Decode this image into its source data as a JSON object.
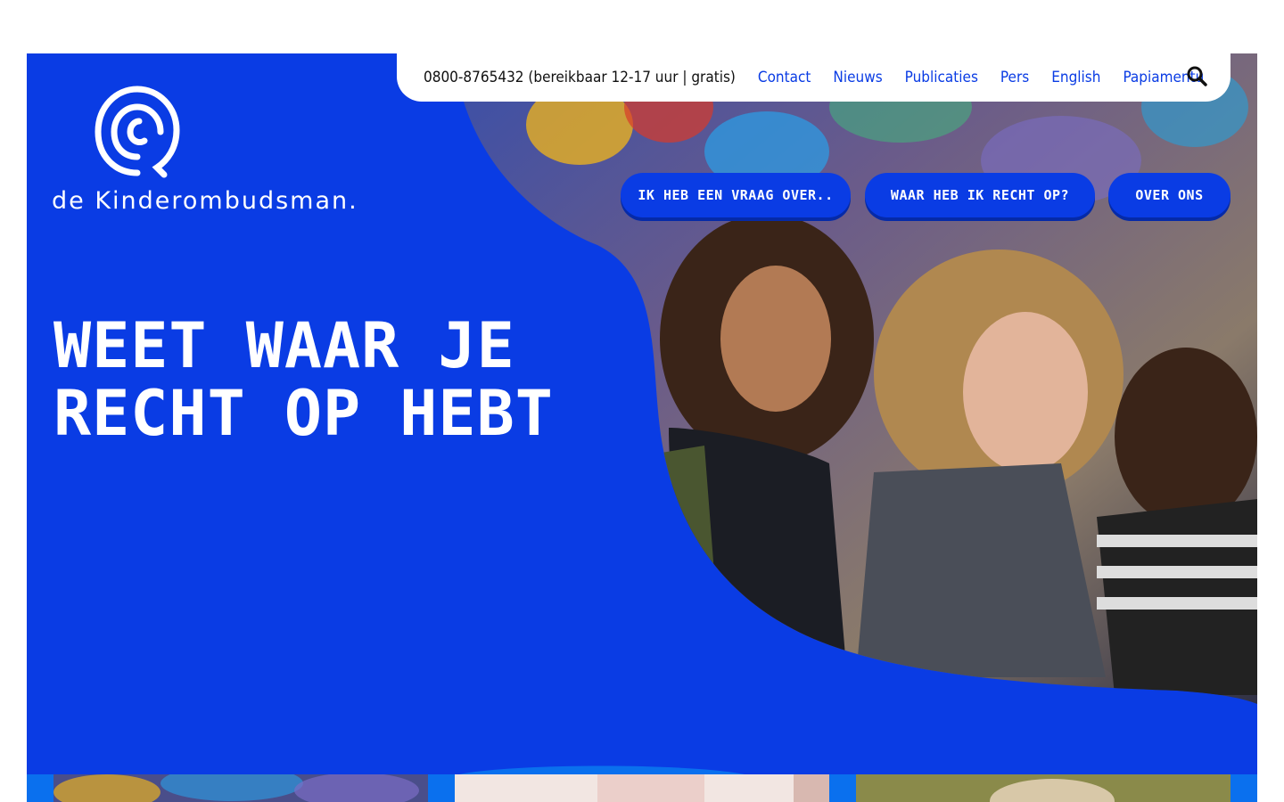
{
  "brand": {
    "name": "de Kinderombudsman.",
    "colors": {
      "primary_blue": "#0a3ce4",
      "light_blue": "#0a70ee",
      "white": "#ffffff"
    }
  },
  "topbar": {
    "phone": "0800-8765432 (bereikbaar 12-17 uur | gratis)",
    "links": [
      "Contact",
      "Nieuws",
      "Publicaties",
      "Pers",
      "English",
      "Papiamentu"
    ],
    "search_icon": "search-icon"
  },
  "nav_buttons": [
    "Ik heb een vraag over..",
    "Waar heb ik recht op?",
    "Over ons"
  ],
  "hero": {
    "headline_line1": "Weet waar je",
    "headline_line2": "recht op hebt"
  }
}
